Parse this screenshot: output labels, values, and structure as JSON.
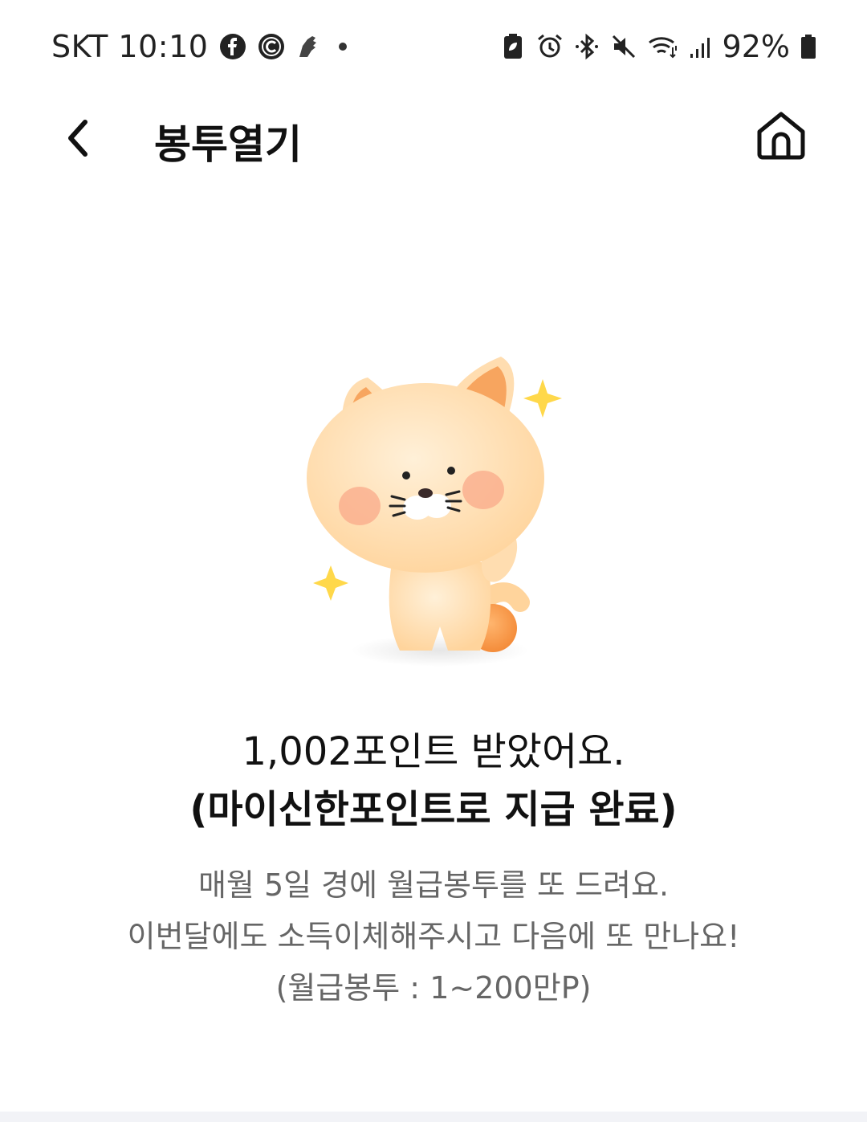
{
  "status_bar": {
    "carrier": "SKT",
    "time": "10:10",
    "battery_percent": "92%",
    "left_icons": [
      "facebook-icon",
      "c-badge-icon",
      "shoe-icon",
      "dot-icon"
    ],
    "right_icons": [
      "battery-saver-icon",
      "alarm-icon",
      "bluetooth-icon",
      "mute-icon",
      "wifi-icon",
      "signal-icon",
      "battery-icon"
    ]
  },
  "app_bar": {
    "title": "봉투열기"
  },
  "result": {
    "line1": "1,002포인트 받았어요.",
    "line2": "(마이신한포인트로 지급 완료)"
  },
  "description": {
    "line1": "매월 5일 경에 월급봉투를 또 드려요.",
    "line2": "이번달에도 소득이체해주시고 다음에 또 만나요!",
    "line3": "(월급봉투 : 1~200만P)"
  },
  "colors": {
    "mascot_body": "#FFE2B8",
    "mascot_accent": "#F7A55F",
    "sparkle": "#FFD84A",
    "subtext": "#666666"
  }
}
